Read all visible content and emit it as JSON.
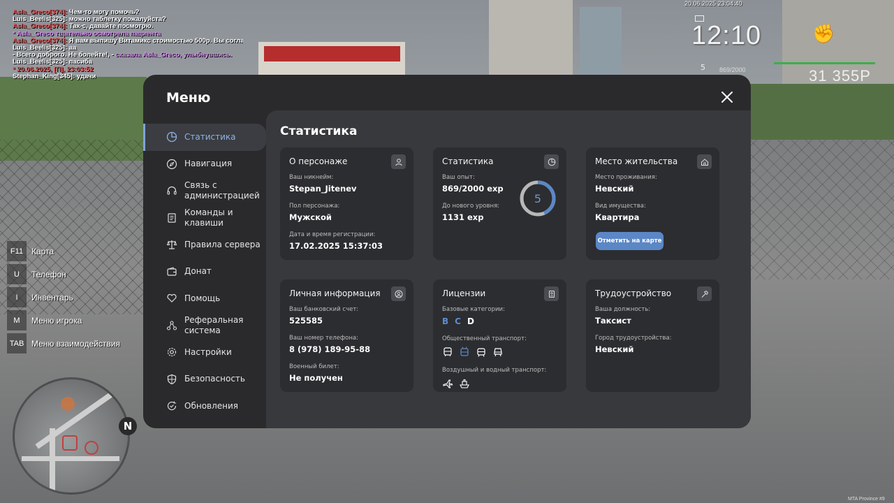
{
  "chat": [
    {
      "name": "Asla_Greco[374]:",
      "name_color": "#e25555",
      "text": " Чем-то могу помочь?",
      "text_color": "#ffffff"
    },
    {
      "name": "",
      "name_color": "#ffffff",
      "text": "Luis_Beelis[325]: можно таблетку пожалуйста?",
      "text_color": "#ffffff"
    },
    {
      "name": "Asla_Greco[374]:",
      "name_color": "#e25555",
      "text": " Так-с, давайте посмотрю.",
      "text_color": "#ffffff"
    },
    {
      "name": "",
      "name_color": "#ffffff",
      "text": "* Asla_Greco тщательно осмотрела пациента",
      "text_color": "#d68cf0"
    },
    {
      "name": "Asla_Greco[374]:",
      "name_color": "#e25555",
      "text": " Я вам выпишу Витамикс стоимостью 500р. Вы согласны?",
      "text_color": "#ffffff"
    },
    {
      "name": "",
      "name_color": "#ffffff",
      "text": "Luis_Beelis[325]: аа",
      "text_color": "#ffffff"
    },
    {
      "name": "",
      "name_color": "#ffffff",
      "text": "- Всего доброго. Не болейте!, - ",
      "text_color": "#ffffff",
      "tail": "сказала Asla_Greco, улыбнувшись.",
      "tail_color": "#d68cf0"
    },
    {
      "name": "",
      "name_color": "#ffffff",
      "text": "Luis_Beelis[325]: пасиба",
      "text_color": "#ffffff"
    },
    {
      "name": "",
      "name_color": "#ffffff",
      "text": "* 20.06.2025, [П], 23:03:52",
      "text_color": "#e25555"
    },
    {
      "name": "",
      "name_color": "#ffffff",
      "text": "Stephan_King[345]: удачи",
      "text_color": "#ffffff"
    }
  ],
  "hud": {
    "date": "20.06.2025 23:04:40",
    "time": "12:10",
    "level": "5",
    "exp": "869/2000",
    "money": "31 355Р"
  },
  "binds": [
    {
      "key": "F11",
      "label": "Карта"
    },
    {
      "key": "U",
      "label": "Телефон"
    },
    {
      "key": "I",
      "label": "Инвентарь"
    },
    {
      "key": "M",
      "label": "Меню игрока"
    },
    {
      "key": "TAB",
      "label": "Меню взаимодействия"
    }
  ],
  "minimap": {
    "north": "N"
  },
  "footer": "MTA Province #9",
  "menu": {
    "title": "Меню",
    "nav": [
      {
        "label": "Статистика",
        "icon": "pie-chart-icon",
        "active": true
      },
      {
        "label": "Навигация",
        "icon": "compass-icon"
      },
      {
        "label": "Связь с администрацией",
        "icon": "headset-icon"
      },
      {
        "label": "Команды и клавиши",
        "icon": "document-icon"
      },
      {
        "label": "Правила сервера",
        "icon": "scales-icon"
      },
      {
        "label": "Донат",
        "icon": "wallet-icon"
      },
      {
        "label": "Помощь",
        "icon": "heart-hands-icon"
      },
      {
        "label": "Реферальная система",
        "icon": "network-icon"
      },
      {
        "label": "Настройки",
        "icon": "gear-icon"
      },
      {
        "label": "Безопасность",
        "icon": "shield-icon"
      },
      {
        "label": "Обновления",
        "icon": "refresh-check-icon"
      }
    ],
    "accent": "#5b87c6"
  },
  "stats": {
    "title": "Статистика",
    "character": {
      "title": "О персонаже",
      "nickname_label": "Ваш никнейм:",
      "nickname": "Stepan_Jitenev",
      "gender_label": "Пол персонажа:",
      "gender": "Мужской",
      "reg_label": "Дата и время регистрации:",
      "reg": "17.02.2025 15:37:03"
    },
    "statistics": {
      "title": "Статистика",
      "exp_label": "Ваш опыт:",
      "exp": "869/2000 exp",
      "next_label": "До нового уровня:",
      "next": "1131 exp",
      "level": "5",
      "progress": 0.4345
    },
    "residence": {
      "title": "Место жительства",
      "place_label": "Место проживания:",
      "place": "Невский",
      "property_label": "Вид имущества:",
      "property": "Квартира",
      "button": "Отметить на карте"
    },
    "personal": {
      "title": "Личная информация",
      "bank_label": "Ваш банковский счет:",
      "bank": "525585",
      "phone_label": "Ваш номер телефона:",
      "phone": "8 (978) 189-95-88",
      "military_label": "Военный билет:",
      "military": "Не получен"
    },
    "licenses": {
      "title": "Лицензии",
      "base_label": "Базовые категории:",
      "cat_b": "B",
      "cat_c": "C",
      "cat_d": "D",
      "public_label": "Общественный транспорт:",
      "air_label": "Воздушный и водный транспорт:"
    },
    "job": {
      "title": "Трудоустройство",
      "position_label": "Ваша должность:",
      "position": "Таксист",
      "city_label": "Город трудоустройства:",
      "city": "Невский"
    }
  }
}
